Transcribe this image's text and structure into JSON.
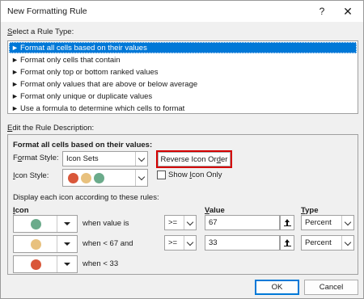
{
  "window": {
    "title": "New Formatting Rule",
    "help_glyph": "?",
    "close_glyph": "✕"
  },
  "rule_type": {
    "label_accel": "S",
    "label_rest": "elect a Rule Type:",
    "items": [
      {
        "label": "Format all cells based on their values",
        "selected": true
      },
      {
        "label": "Format only cells that contain",
        "selected": false
      },
      {
        "label": "Format only top or bottom ranked values",
        "selected": false
      },
      {
        "label": "Format only values that are above or below average",
        "selected": false
      },
      {
        "label": "Format only unique or duplicate values",
        "selected": false
      },
      {
        "label": "Use a formula to determine which cells to format",
        "selected": false
      }
    ],
    "arrow_glyph": "►"
  },
  "description": {
    "label_accel": "E",
    "label_rest": "dit the Rule Description:",
    "heading": "Format all cells based on their values:",
    "format_style": {
      "label_pre": "F",
      "label_accel": "o",
      "label_rest": "rmat Style:",
      "value": "Icon Sets"
    },
    "reverse_button_pre": "Reverse Icon Or",
    "reverse_button_accel": "d",
    "reverse_button_rest": "er",
    "icon_style": {
      "label_accel": "I",
      "label_rest": "con Style:",
      "colors": [
        "#d9573a",
        "#e8c17e",
        "#6bab8b"
      ]
    },
    "show_icon_only": {
      "label_pre": "Show ",
      "label_accel": "I",
      "label_rest": "con Only",
      "checked": false
    },
    "rules_caption": "Display each icon according to these rules:",
    "columns": {
      "icon_accel": "I",
      "icon_rest": "con",
      "value_accel": "V",
      "value_rest": "alue",
      "type_accel": "T",
      "type_rest": "ype"
    },
    "rules": [
      {
        "icon_color": "#6bab8b",
        "condition": "when value is",
        "operator": ">=",
        "value": "67",
        "type": "Percent"
      },
      {
        "icon_color": "#e8c17e",
        "condition": "when < 67 and",
        "operator": ">=",
        "value": "33",
        "type": "Percent"
      },
      {
        "icon_color": "#d9573a",
        "condition": "when < 33"
      }
    ]
  },
  "footer": {
    "ok_label": "OK",
    "cancel_label": "Cancel"
  },
  "colors": {
    "accent": "#0078d7",
    "highlight_outline": "#d40000"
  }
}
